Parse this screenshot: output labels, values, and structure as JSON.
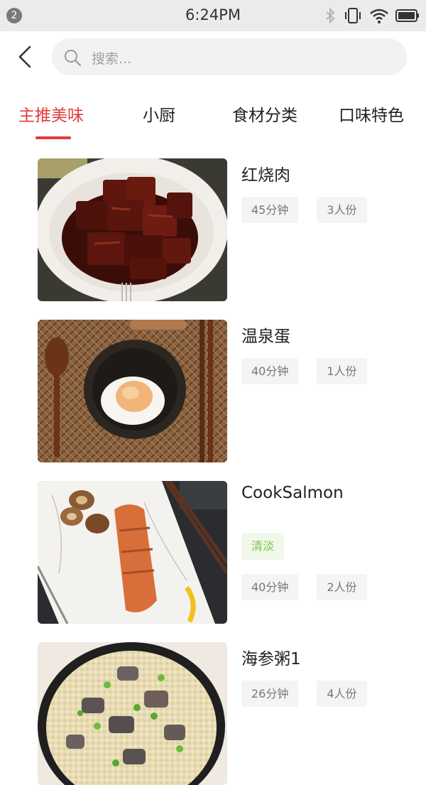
{
  "status_bar": {
    "notification_count": "2",
    "time": "6:24PM"
  },
  "search": {
    "placeholder": "搜索..."
  },
  "tabs": [
    {
      "label": "主推美味",
      "active": true
    },
    {
      "label": "小厨",
      "active": false
    },
    {
      "label": "食材分类",
      "active": false
    },
    {
      "label": "口味特色",
      "active": false
    }
  ],
  "recipes": [
    {
      "title": "红烧肉",
      "time": "45分钟",
      "servings": "3人份",
      "flavor": ""
    },
    {
      "title": "温泉蛋",
      "time": "40分钟",
      "servings": "1人份",
      "flavor": ""
    },
    {
      "title": "CookSalmon",
      "time": "40分钟",
      "servings": "2人份",
      "flavor": "清淡"
    },
    {
      "title": "海参粥1",
      "time": "26分钟",
      "servings": "4人份",
      "flavor": ""
    }
  ],
  "colors": {
    "accent": "#e43b3b",
    "flavor_tag": "#7dc24a",
    "status_bar_bg": "#ebebeb"
  }
}
